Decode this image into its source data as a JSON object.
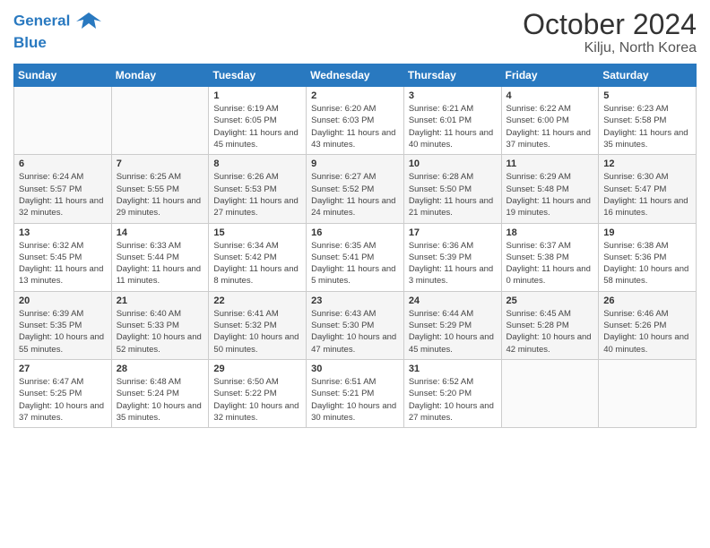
{
  "logo": {
    "line1": "General",
    "line2": "Blue"
  },
  "title": "October 2024",
  "location": "Kilju, North Korea",
  "days_of_week": [
    "Sunday",
    "Monday",
    "Tuesday",
    "Wednesday",
    "Thursday",
    "Friday",
    "Saturday"
  ],
  "weeks": [
    [
      {
        "day": "",
        "sunrise": "",
        "sunset": "",
        "daylight": ""
      },
      {
        "day": "",
        "sunrise": "",
        "sunset": "",
        "daylight": ""
      },
      {
        "day": "1",
        "sunrise": "Sunrise: 6:19 AM",
        "sunset": "Sunset: 6:05 PM",
        "daylight": "Daylight: 11 hours and 45 minutes."
      },
      {
        "day": "2",
        "sunrise": "Sunrise: 6:20 AM",
        "sunset": "Sunset: 6:03 PM",
        "daylight": "Daylight: 11 hours and 43 minutes."
      },
      {
        "day": "3",
        "sunrise": "Sunrise: 6:21 AM",
        "sunset": "Sunset: 6:01 PM",
        "daylight": "Daylight: 11 hours and 40 minutes."
      },
      {
        "day": "4",
        "sunrise": "Sunrise: 6:22 AM",
        "sunset": "Sunset: 6:00 PM",
        "daylight": "Daylight: 11 hours and 37 minutes."
      },
      {
        "day": "5",
        "sunrise": "Sunrise: 6:23 AM",
        "sunset": "Sunset: 5:58 PM",
        "daylight": "Daylight: 11 hours and 35 minutes."
      }
    ],
    [
      {
        "day": "6",
        "sunrise": "Sunrise: 6:24 AM",
        "sunset": "Sunset: 5:57 PM",
        "daylight": "Daylight: 11 hours and 32 minutes."
      },
      {
        "day": "7",
        "sunrise": "Sunrise: 6:25 AM",
        "sunset": "Sunset: 5:55 PM",
        "daylight": "Daylight: 11 hours and 29 minutes."
      },
      {
        "day": "8",
        "sunrise": "Sunrise: 6:26 AM",
        "sunset": "Sunset: 5:53 PM",
        "daylight": "Daylight: 11 hours and 27 minutes."
      },
      {
        "day": "9",
        "sunrise": "Sunrise: 6:27 AM",
        "sunset": "Sunset: 5:52 PM",
        "daylight": "Daylight: 11 hours and 24 minutes."
      },
      {
        "day": "10",
        "sunrise": "Sunrise: 6:28 AM",
        "sunset": "Sunset: 5:50 PM",
        "daylight": "Daylight: 11 hours and 21 minutes."
      },
      {
        "day": "11",
        "sunrise": "Sunrise: 6:29 AM",
        "sunset": "Sunset: 5:48 PM",
        "daylight": "Daylight: 11 hours and 19 minutes."
      },
      {
        "day": "12",
        "sunrise": "Sunrise: 6:30 AM",
        "sunset": "Sunset: 5:47 PM",
        "daylight": "Daylight: 11 hours and 16 minutes."
      }
    ],
    [
      {
        "day": "13",
        "sunrise": "Sunrise: 6:32 AM",
        "sunset": "Sunset: 5:45 PM",
        "daylight": "Daylight: 11 hours and 13 minutes."
      },
      {
        "day": "14",
        "sunrise": "Sunrise: 6:33 AM",
        "sunset": "Sunset: 5:44 PM",
        "daylight": "Daylight: 11 hours and 11 minutes."
      },
      {
        "day": "15",
        "sunrise": "Sunrise: 6:34 AM",
        "sunset": "Sunset: 5:42 PM",
        "daylight": "Daylight: 11 hours and 8 minutes."
      },
      {
        "day": "16",
        "sunrise": "Sunrise: 6:35 AM",
        "sunset": "Sunset: 5:41 PM",
        "daylight": "Daylight: 11 hours and 5 minutes."
      },
      {
        "day": "17",
        "sunrise": "Sunrise: 6:36 AM",
        "sunset": "Sunset: 5:39 PM",
        "daylight": "Daylight: 11 hours and 3 minutes."
      },
      {
        "day": "18",
        "sunrise": "Sunrise: 6:37 AM",
        "sunset": "Sunset: 5:38 PM",
        "daylight": "Daylight: 11 hours and 0 minutes."
      },
      {
        "day": "19",
        "sunrise": "Sunrise: 6:38 AM",
        "sunset": "Sunset: 5:36 PM",
        "daylight": "Daylight: 10 hours and 58 minutes."
      }
    ],
    [
      {
        "day": "20",
        "sunrise": "Sunrise: 6:39 AM",
        "sunset": "Sunset: 5:35 PM",
        "daylight": "Daylight: 10 hours and 55 minutes."
      },
      {
        "day": "21",
        "sunrise": "Sunrise: 6:40 AM",
        "sunset": "Sunset: 5:33 PM",
        "daylight": "Daylight: 10 hours and 52 minutes."
      },
      {
        "day": "22",
        "sunrise": "Sunrise: 6:41 AM",
        "sunset": "Sunset: 5:32 PM",
        "daylight": "Daylight: 10 hours and 50 minutes."
      },
      {
        "day": "23",
        "sunrise": "Sunrise: 6:43 AM",
        "sunset": "Sunset: 5:30 PM",
        "daylight": "Daylight: 10 hours and 47 minutes."
      },
      {
        "day": "24",
        "sunrise": "Sunrise: 6:44 AM",
        "sunset": "Sunset: 5:29 PM",
        "daylight": "Daylight: 10 hours and 45 minutes."
      },
      {
        "day": "25",
        "sunrise": "Sunrise: 6:45 AM",
        "sunset": "Sunset: 5:28 PM",
        "daylight": "Daylight: 10 hours and 42 minutes."
      },
      {
        "day": "26",
        "sunrise": "Sunrise: 6:46 AM",
        "sunset": "Sunset: 5:26 PM",
        "daylight": "Daylight: 10 hours and 40 minutes."
      }
    ],
    [
      {
        "day": "27",
        "sunrise": "Sunrise: 6:47 AM",
        "sunset": "Sunset: 5:25 PM",
        "daylight": "Daylight: 10 hours and 37 minutes."
      },
      {
        "day": "28",
        "sunrise": "Sunrise: 6:48 AM",
        "sunset": "Sunset: 5:24 PM",
        "daylight": "Daylight: 10 hours and 35 minutes."
      },
      {
        "day": "29",
        "sunrise": "Sunrise: 6:50 AM",
        "sunset": "Sunset: 5:22 PM",
        "daylight": "Daylight: 10 hours and 32 minutes."
      },
      {
        "day": "30",
        "sunrise": "Sunrise: 6:51 AM",
        "sunset": "Sunset: 5:21 PM",
        "daylight": "Daylight: 10 hours and 30 minutes."
      },
      {
        "day": "31",
        "sunrise": "Sunrise: 6:52 AM",
        "sunset": "Sunset: 5:20 PM",
        "daylight": "Daylight: 10 hours and 27 minutes."
      },
      {
        "day": "",
        "sunrise": "",
        "sunset": "",
        "daylight": ""
      },
      {
        "day": "",
        "sunrise": "",
        "sunset": "",
        "daylight": ""
      }
    ]
  ]
}
